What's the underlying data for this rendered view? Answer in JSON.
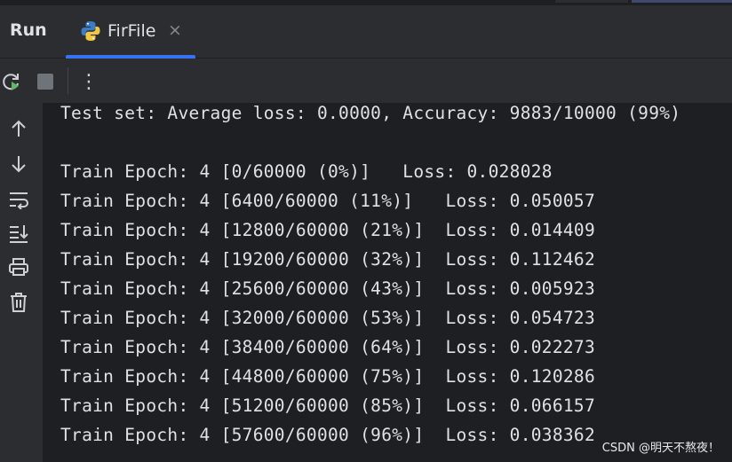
{
  "tool_window": {
    "title": "Run",
    "tab": {
      "label": "FirFile",
      "close_glyph": "×",
      "icon": "python-icon"
    }
  },
  "toolbar": {
    "rerun_icon": "rerun-icon",
    "stop_icon": "stop-icon",
    "more_glyph": "⋮"
  },
  "gutter": {
    "icons": [
      "up-arrow-icon",
      "down-arrow-icon",
      "soft-wrap-icon",
      "scroll-to-end-icon",
      "print-icon",
      "trash-icon"
    ]
  },
  "console": {
    "lines": [
      "Test set: Average loss: 0.0000, Accuracy: 9883/10000 (99%)",
      "",
      "Train Epoch: 4 [0/60000 (0%)]   Loss: 0.028028",
      "Train Epoch: 4 [6400/60000 (11%)]   Loss: 0.050057",
      "Train Epoch: 4 [12800/60000 (21%)]  Loss: 0.014409",
      "Train Epoch: 4 [19200/60000 (32%)]  Loss: 0.112462",
      "Train Epoch: 4 [25600/60000 (43%)]  Loss: 0.005923",
      "Train Epoch: 4 [32000/60000 (53%)]  Loss: 0.054723",
      "Train Epoch: 4 [38400/60000 (64%)]  Loss: 0.022273",
      "Train Epoch: 4 [44800/60000 (75%)]  Loss: 0.120286",
      "Train Epoch: 4 [51200/60000 (85%)]  Loss: 0.066157",
      "Train Epoch: 4 [57600/60000 (96%)]  Loss: 0.038362"
    ]
  },
  "watermark": "CSDN @明天不熬夜！",
  "colors": {
    "accent": "#3574f0",
    "panel_bg": "#2b2d30",
    "console_bg": "#1e1f22",
    "text": "#dfe1e5"
  }
}
